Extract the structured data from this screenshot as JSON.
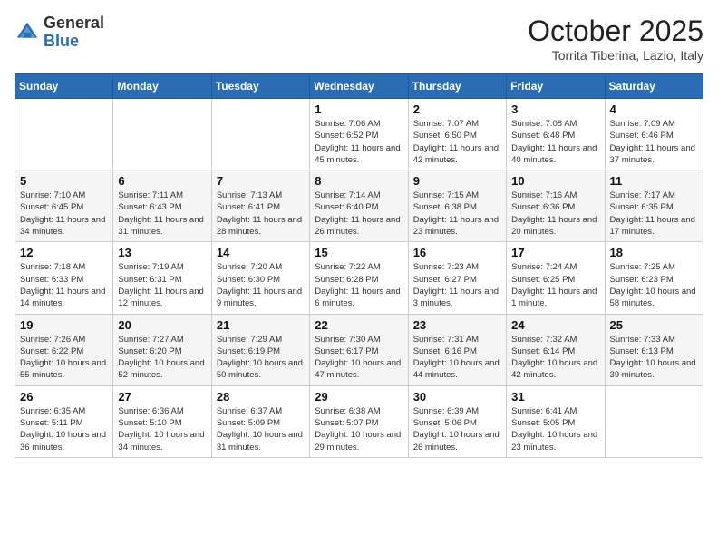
{
  "header": {
    "logo_line1": "General",
    "logo_line2": "Blue",
    "month_title": "October 2025",
    "subtitle": "Torrita Tiberina, Lazio, Italy"
  },
  "weekdays": [
    "Sunday",
    "Monday",
    "Tuesday",
    "Wednesday",
    "Thursday",
    "Friday",
    "Saturday"
  ],
  "weeks": [
    [
      {
        "day": "",
        "info": ""
      },
      {
        "day": "",
        "info": ""
      },
      {
        "day": "",
        "info": ""
      },
      {
        "day": "1",
        "info": "Sunrise: 7:06 AM\nSunset: 6:52 PM\nDaylight: 11 hours and 45 minutes."
      },
      {
        "day": "2",
        "info": "Sunrise: 7:07 AM\nSunset: 6:50 PM\nDaylight: 11 hours and 42 minutes."
      },
      {
        "day": "3",
        "info": "Sunrise: 7:08 AM\nSunset: 6:48 PM\nDaylight: 11 hours and 40 minutes."
      },
      {
        "day": "4",
        "info": "Sunrise: 7:09 AM\nSunset: 6:46 PM\nDaylight: 11 hours and 37 minutes."
      }
    ],
    [
      {
        "day": "5",
        "info": "Sunrise: 7:10 AM\nSunset: 6:45 PM\nDaylight: 11 hours and 34 minutes."
      },
      {
        "day": "6",
        "info": "Sunrise: 7:11 AM\nSunset: 6:43 PM\nDaylight: 11 hours and 31 minutes."
      },
      {
        "day": "7",
        "info": "Sunrise: 7:13 AM\nSunset: 6:41 PM\nDaylight: 11 hours and 28 minutes."
      },
      {
        "day": "8",
        "info": "Sunrise: 7:14 AM\nSunset: 6:40 PM\nDaylight: 11 hours and 26 minutes."
      },
      {
        "day": "9",
        "info": "Sunrise: 7:15 AM\nSunset: 6:38 PM\nDaylight: 11 hours and 23 minutes."
      },
      {
        "day": "10",
        "info": "Sunrise: 7:16 AM\nSunset: 6:36 PM\nDaylight: 11 hours and 20 minutes."
      },
      {
        "day": "11",
        "info": "Sunrise: 7:17 AM\nSunset: 6:35 PM\nDaylight: 11 hours and 17 minutes."
      }
    ],
    [
      {
        "day": "12",
        "info": "Sunrise: 7:18 AM\nSunset: 6:33 PM\nDaylight: 11 hours and 14 minutes."
      },
      {
        "day": "13",
        "info": "Sunrise: 7:19 AM\nSunset: 6:31 PM\nDaylight: 11 hours and 12 minutes."
      },
      {
        "day": "14",
        "info": "Sunrise: 7:20 AM\nSunset: 6:30 PM\nDaylight: 11 hours and 9 minutes."
      },
      {
        "day": "15",
        "info": "Sunrise: 7:22 AM\nSunset: 6:28 PM\nDaylight: 11 hours and 6 minutes."
      },
      {
        "day": "16",
        "info": "Sunrise: 7:23 AM\nSunset: 6:27 PM\nDaylight: 11 hours and 3 minutes."
      },
      {
        "day": "17",
        "info": "Sunrise: 7:24 AM\nSunset: 6:25 PM\nDaylight: 11 hours and 1 minute."
      },
      {
        "day": "18",
        "info": "Sunrise: 7:25 AM\nSunset: 6:23 PM\nDaylight: 10 hours and 58 minutes."
      }
    ],
    [
      {
        "day": "19",
        "info": "Sunrise: 7:26 AM\nSunset: 6:22 PM\nDaylight: 10 hours and 55 minutes."
      },
      {
        "day": "20",
        "info": "Sunrise: 7:27 AM\nSunset: 6:20 PM\nDaylight: 10 hours and 52 minutes."
      },
      {
        "day": "21",
        "info": "Sunrise: 7:29 AM\nSunset: 6:19 PM\nDaylight: 10 hours and 50 minutes."
      },
      {
        "day": "22",
        "info": "Sunrise: 7:30 AM\nSunset: 6:17 PM\nDaylight: 10 hours and 47 minutes."
      },
      {
        "day": "23",
        "info": "Sunrise: 7:31 AM\nSunset: 6:16 PM\nDaylight: 10 hours and 44 minutes."
      },
      {
        "day": "24",
        "info": "Sunrise: 7:32 AM\nSunset: 6:14 PM\nDaylight: 10 hours and 42 minutes."
      },
      {
        "day": "25",
        "info": "Sunrise: 7:33 AM\nSunset: 6:13 PM\nDaylight: 10 hours and 39 minutes."
      }
    ],
    [
      {
        "day": "26",
        "info": "Sunrise: 6:35 AM\nSunset: 5:11 PM\nDaylight: 10 hours and 36 minutes."
      },
      {
        "day": "27",
        "info": "Sunrise: 6:36 AM\nSunset: 5:10 PM\nDaylight: 10 hours and 34 minutes."
      },
      {
        "day": "28",
        "info": "Sunrise: 6:37 AM\nSunset: 5:09 PM\nDaylight: 10 hours and 31 minutes."
      },
      {
        "day": "29",
        "info": "Sunrise: 6:38 AM\nSunset: 5:07 PM\nDaylight: 10 hours and 29 minutes."
      },
      {
        "day": "30",
        "info": "Sunrise: 6:39 AM\nSunset: 5:06 PM\nDaylight: 10 hours and 26 minutes."
      },
      {
        "day": "31",
        "info": "Sunrise: 6:41 AM\nSunset: 5:05 PM\nDaylight: 10 hours and 23 minutes."
      },
      {
        "day": "",
        "info": ""
      }
    ]
  ]
}
